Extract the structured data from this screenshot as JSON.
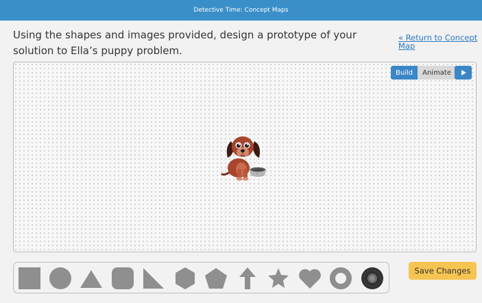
{
  "header": {
    "title": "Detective Time: Concept Maps"
  },
  "instructions": "Using the shapes and images provided, design a prototype of your solution to Ella’s puppy problem.",
  "links": {
    "return_concept_map": "« Return to Concept Map"
  },
  "mode_toggle": {
    "build": "Build",
    "animate": "Animate",
    "active": "Build"
  },
  "play_icon": "play-icon",
  "canvas_items": [
    "puppy-with-bowl"
  ],
  "shapes": [
    "square",
    "circle",
    "triangle",
    "rounded-square",
    "right-triangle",
    "hexagon",
    "pentagon",
    "arrow-up",
    "star",
    "heart",
    "ring",
    "tire"
  ],
  "save_button": {
    "label": "Save Changes"
  },
  "colors": {
    "header": "#3a8fc8",
    "accent": "#3a86c7",
    "save": "#f6c451",
    "shape": "#8f8f8f"
  }
}
